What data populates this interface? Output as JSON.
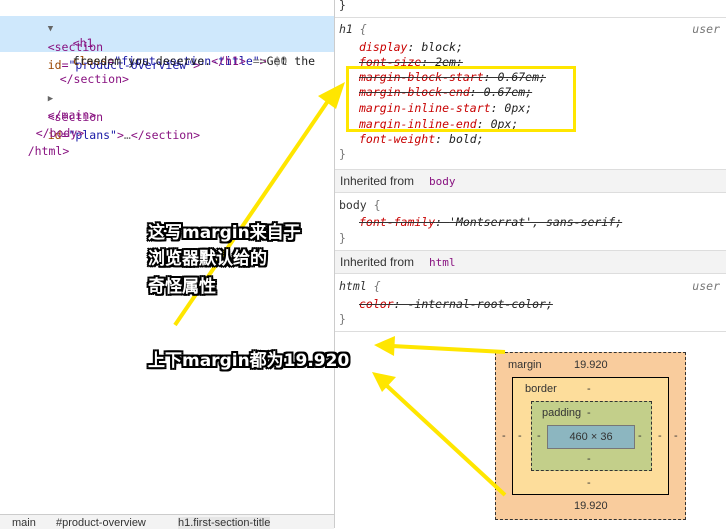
{
  "elements_panel": {
    "lines": {
      "section_open": {
        "tag_open": "<section",
        "attr_name": "id",
        "attr_value": "\"product-overview\"",
        "tag_close": ">"
      },
      "h1_line1": {
        "tag_open": "<h1",
        "attr_name": "class",
        "attr_value": "\"first-section-title\"",
        "tag_close": ">",
        "text": "Get the"
      },
      "h1_line2": {
        "text": "freedom you deserve.",
        "tag_end": "</h1>",
        "suffix": " == $0"
      },
      "section_close": "</section>",
      "plans": {
        "tag_open": "<section",
        "attr_name": "id",
        "attr_value": "\"plans\"",
        "tag_close": ">",
        "ellipsis": "…",
        "tag_end": "</section>"
      },
      "main_close": "</main>",
      "body_close": "</body>",
      "html_close": "/html>"
    },
    "breadcrumbs": [
      "main",
      "#product-overview",
      "h1.first-section-title"
    ]
  },
  "styles_panel": {
    "top_brace": "}",
    "h1_rule": {
      "selector": "h1",
      "open": "{",
      "source": "user",
      "declarations": [
        {
          "prop": "display",
          "value": "block",
          "struck": false
        },
        {
          "prop": "font-size",
          "value": "2em",
          "struck": true
        },
        {
          "prop": "margin-block-start",
          "value": "0.67em",
          "struck": true
        },
        {
          "prop": "margin-block-end",
          "value": "0.67em",
          "struck": true
        },
        {
          "prop": "margin-inline-start",
          "value": "0px",
          "struck": false
        },
        {
          "prop": "margin-inline-end",
          "value": "0px",
          "struck": false
        },
        {
          "prop": "font-weight",
          "value": "bold",
          "struck": false
        }
      ],
      "close": "}"
    },
    "inherited_body": {
      "label": "Inherited from",
      "tag": "body"
    },
    "body_rule": {
      "selector": "body",
      "open": "{",
      "declarations": [
        {
          "prop": "font-family",
          "value": "'Montserrat', sans-serif",
          "struck": true
        }
      ],
      "close": "}"
    },
    "inherited_html": {
      "label": "Inherited from",
      "tag": "html"
    },
    "html_rule": {
      "selector": "html",
      "open": "{",
      "source": "user",
      "declarations": [
        {
          "prop": "color",
          "value": "-internal-root-color",
          "struck": true
        }
      ],
      "close": "}"
    }
  },
  "box_model": {
    "margin_label": "margin",
    "margin_top": "19.920",
    "margin_bottom": "19.920",
    "margin_left": "-",
    "margin_right": "-",
    "border_label": "border",
    "border_top": "-",
    "border_bottom": "-",
    "border_left": "-",
    "border_right": "-",
    "padding_label": "padding",
    "padding_top": "-",
    "padding_bottom": "-",
    "padding_left": "-",
    "padding_right": "-",
    "content": "460 × 36"
  },
  "annotations": {
    "note1": [
      "这写margin来自于",
      "浏览器默认给的",
      "奇怪属性"
    ],
    "note2": "上下margin都为19.920",
    "highlight_color": "#ffe600"
  }
}
